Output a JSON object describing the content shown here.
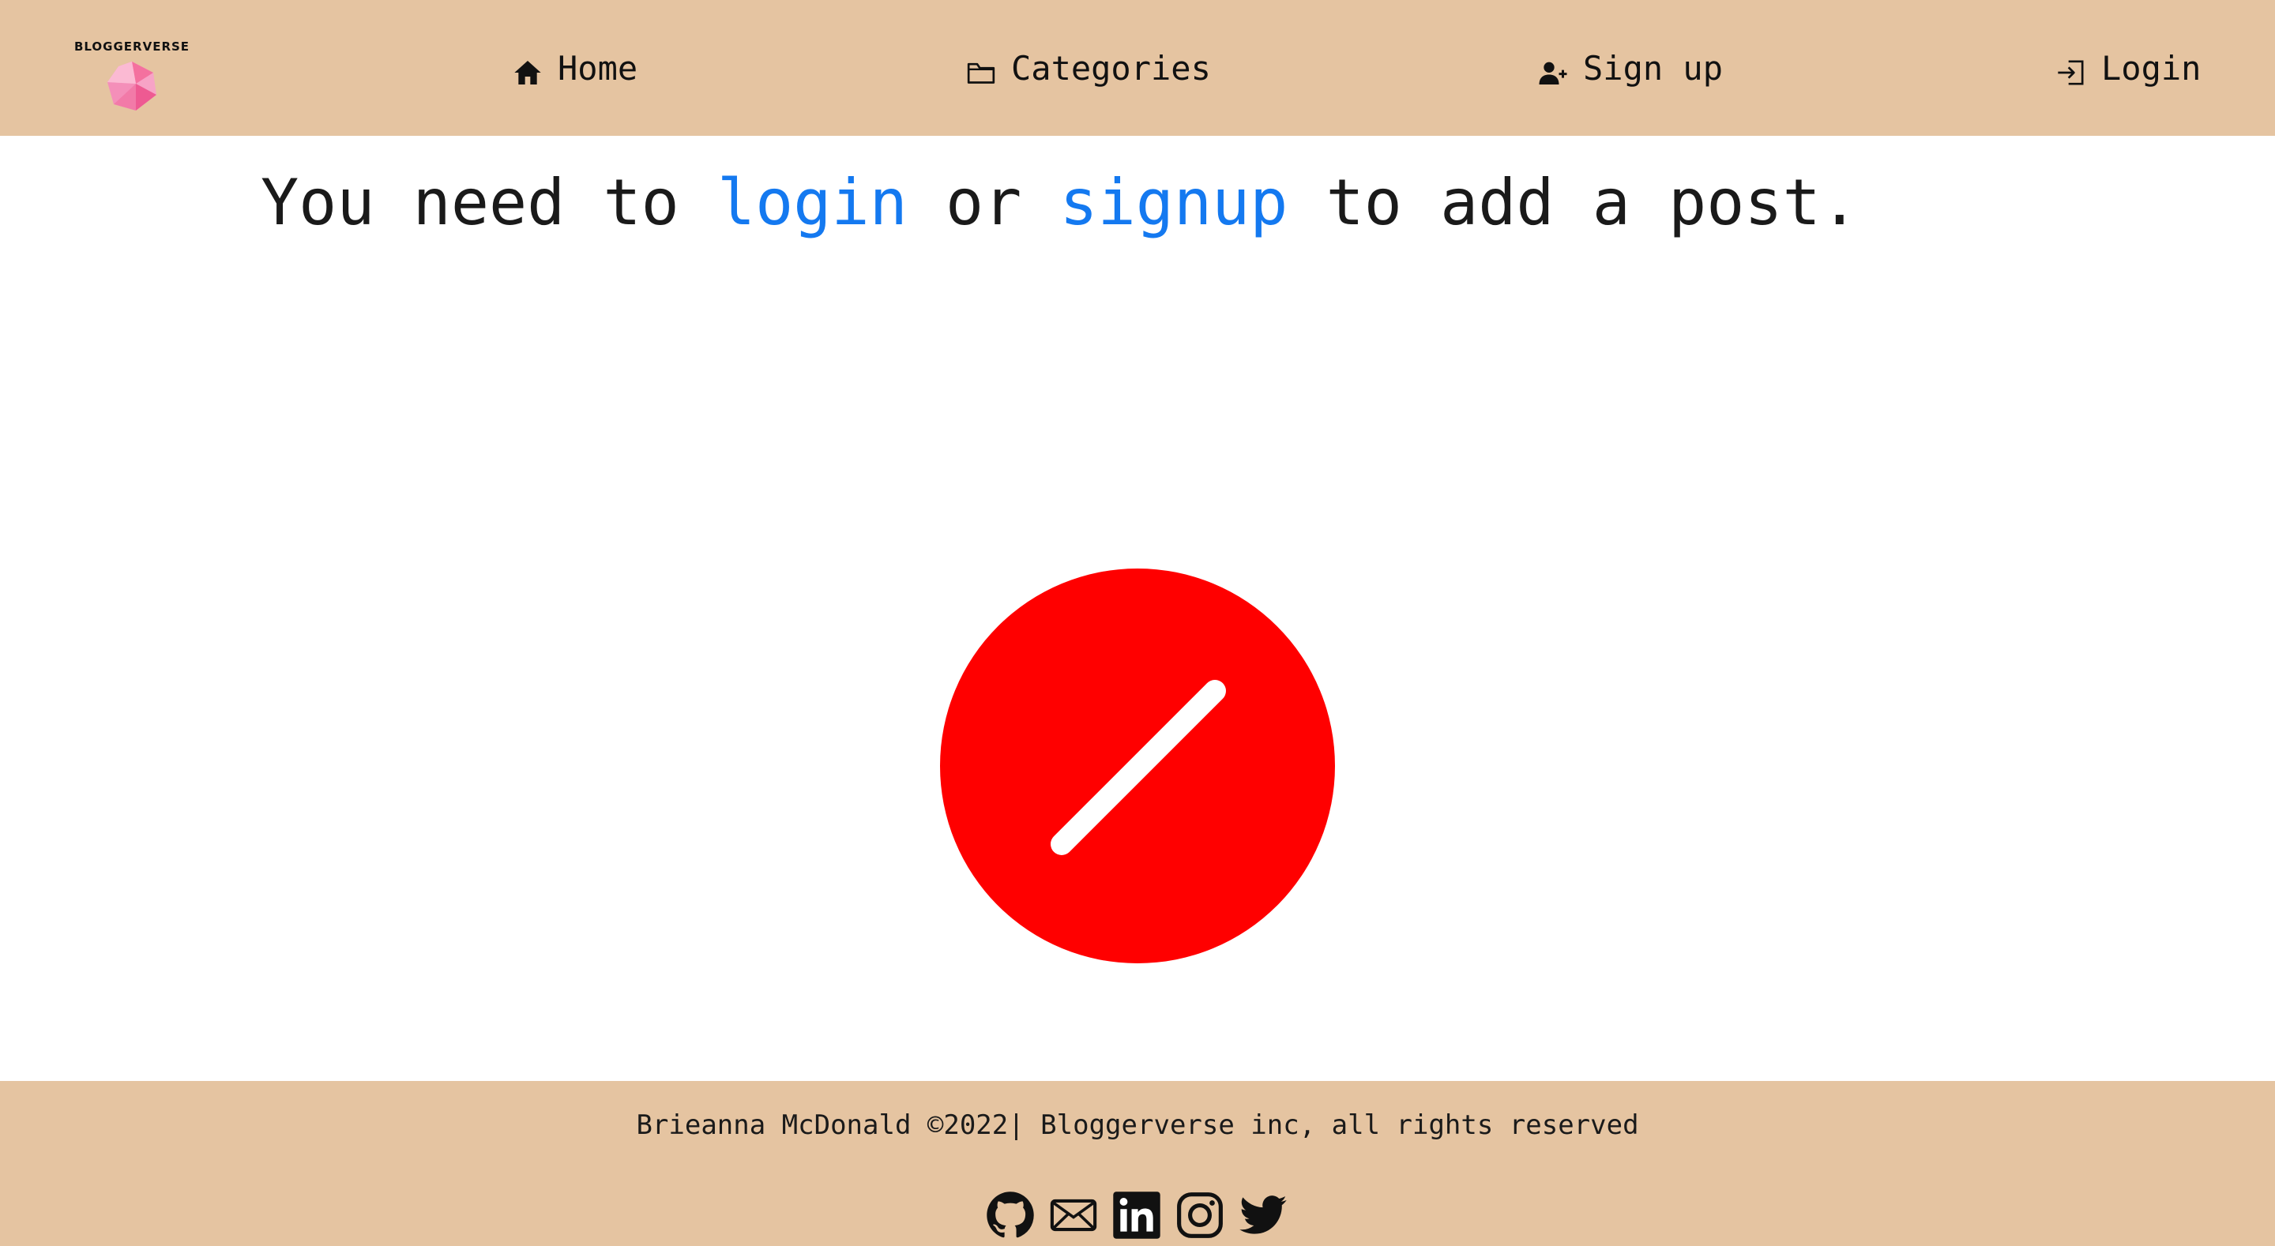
{
  "brand": {
    "name": "BLOGGERVERSE",
    "logo_icon": "pink-gem-icon"
  },
  "nav": {
    "items": [
      {
        "label": "Home",
        "icon": "home-icon"
      },
      {
        "label": "Categories",
        "icon": "folder-icon"
      },
      {
        "label": "Sign up",
        "icon": "user-plus-icon"
      },
      {
        "label": "Login",
        "icon": "login-icon"
      }
    ]
  },
  "main": {
    "message_prefix": "You need to ",
    "login_link": "login",
    "message_middle": " or ",
    "signup_link": "signup",
    "message_suffix": " to add a post.",
    "status_icon": "forbidden-icon"
  },
  "footer": {
    "copyright": "Brieanna McDonald ©2022| Bloggerverse inc, all rights reserved",
    "socials": [
      {
        "name": "GitHub",
        "icon": "github-icon"
      },
      {
        "name": "Email",
        "icon": "mail-icon"
      },
      {
        "name": "LinkedIn",
        "icon": "linkedin-icon"
      },
      {
        "name": "Instagram",
        "icon": "instagram-icon"
      },
      {
        "name": "Twitter",
        "icon": "twitter-icon"
      }
    ]
  },
  "colors": {
    "header_bg": "#e5c4a1",
    "link": "#1479f0",
    "forbidden_red": "#ff0000",
    "text": "#1a1a1a"
  }
}
